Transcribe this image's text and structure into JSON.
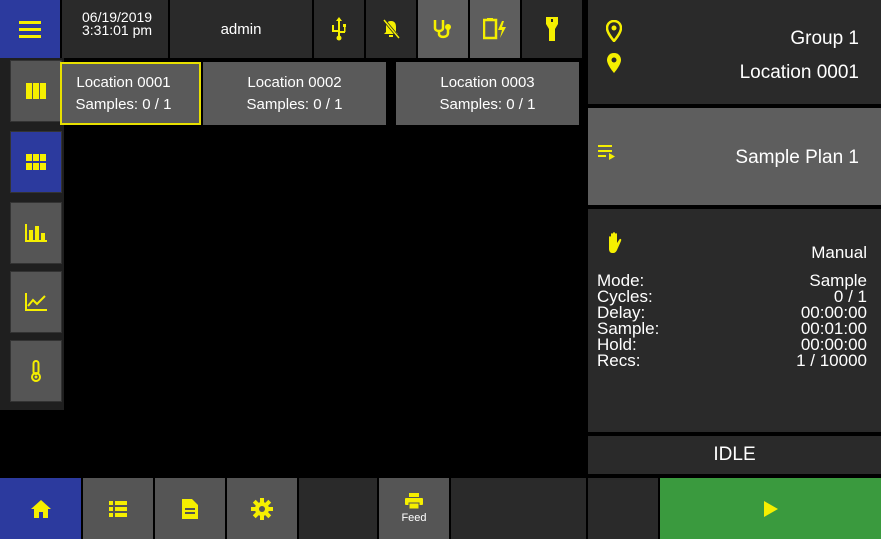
{
  "header": {
    "date": "06/19/2019",
    "time": "3:31:01 pm",
    "user": "admin",
    "icons": [
      "menu-icon",
      "usb-icon",
      "alarm-off-icon",
      "stethoscope-icon",
      "battery-charging-icon",
      "flashlight-icon"
    ]
  },
  "sidebar": {
    "items": [
      {
        "name": "columns-view",
        "active": false
      },
      {
        "name": "grid-view",
        "active": true
      },
      {
        "name": "bar-chart",
        "active": false
      },
      {
        "name": "line-chart",
        "active": false
      },
      {
        "name": "thermometer",
        "active": false
      }
    ]
  },
  "locations": [
    {
      "name": "Location 0001",
      "samples": "Samples: 0 / 1",
      "selected": true
    },
    {
      "name": "Location 0002",
      "samples": "Samples: 0 / 1",
      "selected": false
    },
    {
      "name": "Location 0003",
      "samples": "Samples: 0 / 1",
      "selected": false
    }
  ],
  "right_panel": {
    "group": "Group 1",
    "location": "Location 0001",
    "sample_plan": "Sample Plan 1",
    "manual_label": "Manual",
    "stats": [
      {
        "label": "Mode:",
        "value": "Sample"
      },
      {
        "label": "Cycles:",
        "value": "0 / 1"
      },
      {
        "label": "Delay:",
        "value": "00:00:00"
      },
      {
        "label": "Sample:",
        "value": "00:01:00"
      },
      {
        "label": "Hold:",
        "value": "00:00:00"
      },
      {
        "label": "Recs:",
        "value": "1 / 10000"
      }
    ],
    "status": "IDLE"
  },
  "bottom": {
    "feed_label": "Feed"
  },
  "colors": {
    "accent_yellow": "#f5ef00",
    "active_blue": "#2c3a9e",
    "play_green": "#3a9a3e",
    "panel_dark": "#2a2a2a",
    "panel_gray": "#5e5e5e"
  }
}
